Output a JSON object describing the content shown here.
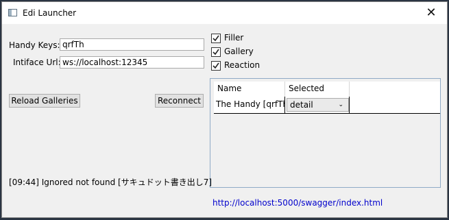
{
  "window": {
    "title": "Edi Launcher",
    "close_glyph": "✕"
  },
  "form": {
    "handy_keys_label": "Handy Keys:",
    "handy_keys_value": "qrfTh",
    "intiface_url_label": "Intiface Url:",
    "intiface_url_value": "ws://localhost:12345"
  },
  "buttons": {
    "reload_galleries": "Reload Galleries",
    "reconnect": "Reconnect"
  },
  "checkboxes": [
    {
      "label": "Filler",
      "checked": true
    },
    {
      "label": "Gallery",
      "checked": true
    },
    {
      "label": "Reaction",
      "checked": true
    }
  ],
  "grid": {
    "columns": [
      "Name",
      "Selected Variant"
    ],
    "rows": [
      {
        "name": "The Handy [qrfTh]",
        "variant": "detail"
      }
    ]
  },
  "log": "[09:44] Ignored not found [サキュドット書き出し7]",
  "link": "http://localhost:5000/swagger/index.html"
}
